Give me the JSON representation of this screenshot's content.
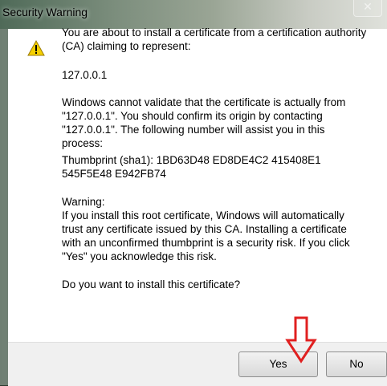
{
  "window": {
    "title": "Security Warning",
    "close_glyph": "✕"
  },
  "message": {
    "intro": "You are about to install a certificate from a certification authority (CA) claiming to represent:",
    "host": "127.0.0.1",
    "validate": "Windows cannot validate that the certificate is actually from \"127.0.0.1\". You should confirm its origin by contacting \"127.0.0.1\". The following number will assist you in this process:",
    "thumbprint": "Thumbprint (sha1): 1BD63D48 ED8DE4C2 415408E1 545F5E48 E942FB74",
    "warning_heading": "Warning:",
    "warning_body": "If you install this root certificate, Windows will automatically trust any certificate issued by this CA. Installing a certificate with an unconfirmed thumbprint is a security risk. If you click \"Yes\" you acknowledge this risk.",
    "question": "Do you want to install this certificate?"
  },
  "buttons": {
    "yes": "Yes",
    "no": "No"
  },
  "icons": {
    "warning": "warning-triangle-icon",
    "annotation_arrow": "red-down-arrow"
  },
  "colors": {
    "warning_fill": "#f5d000",
    "arrow_stroke": "#e02020"
  }
}
